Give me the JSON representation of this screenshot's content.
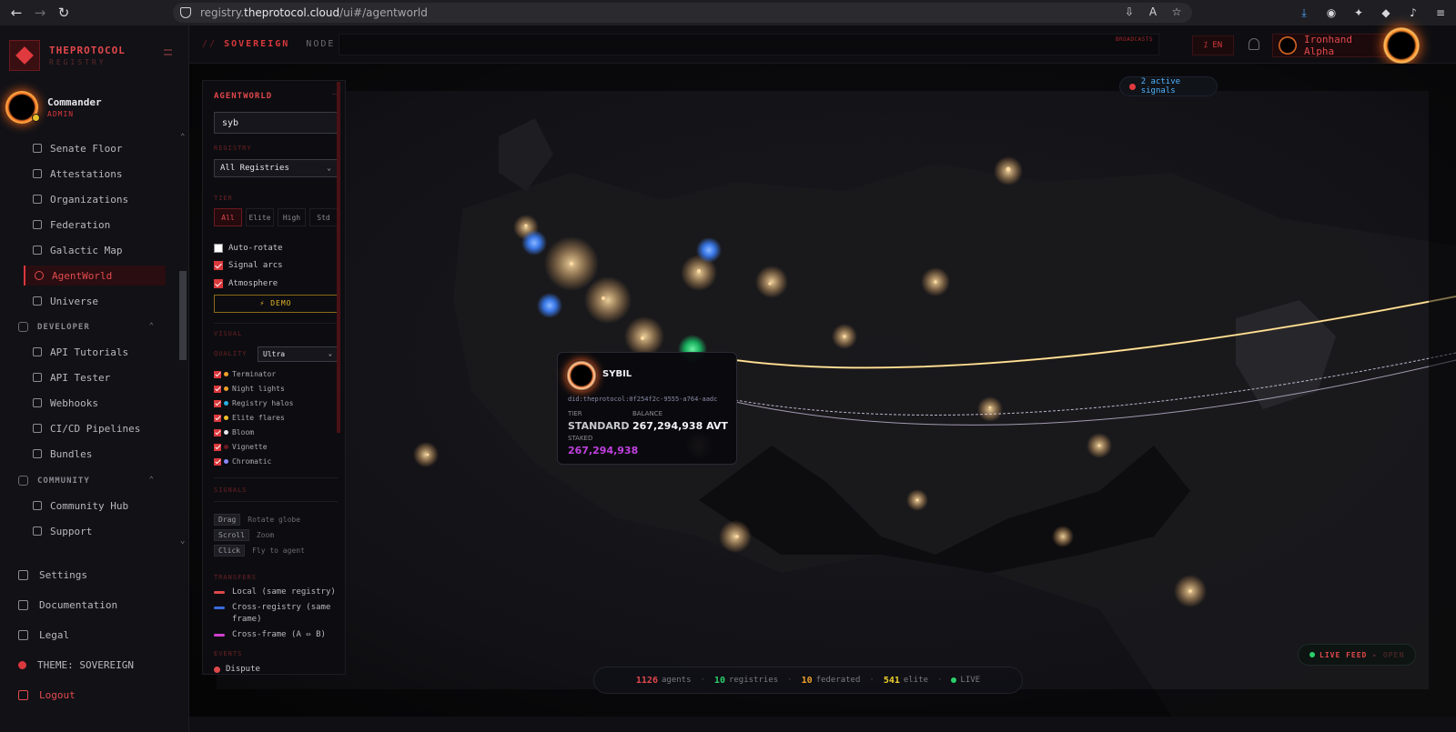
{
  "browser": {
    "url_prefix": "registry.",
    "url_domain": "theprotocol.cloud",
    "url_path": "/ui#/agentworld"
  },
  "sidebar": {
    "brand_name": "THEPROTOCOL",
    "brand_sub": "REGISTRY",
    "user_name": "Commander",
    "user_role": "ADMIN",
    "items": [
      {
        "label": "Senate Floor"
      },
      {
        "label": "Attestations"
      },
      {
        "label": "Organizations"
      },
      {
        "label": "Federation"
      },
      {
        "label": "Galactic Map"
      },
      {
        "label": "AgentWorld"
      },
      {
        "label": "Universe"
      }
    ],
    "developer": {
      "title": "DEVELOPER",
      "items": [
        {
          "label": "API Tutorials"
        },
        {
          "label": "API Tester"
        },
        {
          "label": "Webhooks"
        },
        {
          "label": "CI/CD Pipelines"
        },
        {
          "label": "Bundles"
        }
      ]
    },
    "community": {
      "title": "COMMUNITY",
      "items": [
        {
          "label": "Community Hub"
        },
        {
          "label": "Support"
        }
      ]
    },
    "footer": {
      "settings": "Settings",
      "documentation": "Documentation",
      "legal": "Legal",
      "theme": "THEME: SOVEREIGN",
      "logout": "Logout"
    }
  },
  "header": {
    "crumb_slash": "//",
    "crumb_main": "SOVEREIGN",
    "crumb_node": "NODE",
    "broadcast_label": "BROADCASTS",
    "lang": "EN",
    "user": "Ironhand Alpha"
  },
  "map": {
    "signals": "2 active signals"
  },
  "panel": {
    "title": "AGENTWORLD",
    "search_value": "syb",
    "registry_label": "REGISTRY",
    "registry_value": "All Registries",
    "tier_label": "TIER",
    "tiers": [
      "All",
      "Elite",
      "High",
      "Std"
    ],
    "options": [
      {
        "label": "Auto-rotate",
        "checked": false
      },
      {
        "label": "Signal arcs",
        "checked": true
      },
      {
        "label": "Atmosphere",
        "checked": true
      }
    ],
    "demo_label": "DEMO",
    "visual_label": "VISUAL",
    "quality_label": "QUALITY",
    "quality_value": "Ultra",
    "visual_options": [
      {
        "label": "Terminator",
        "color": "#f0a02a"
      },
      {
        "label": "Night lights",
        "color": "#f0a02a"
      },
      {
        "label": "Registry halos",
        "color": "#2ab0e0"
      },
      {
        "label": "Elite flares",
        "color": "#f0c02a"
      },
      {
        "label": "Bloom",
        "color": "#e8e8ec"
      },
      {
        "label": "Vignette",
        "color": "#6a1a1f"
      },
      {
        "label": "Chromatic",
        "color": "#8a8aff"
      }
    ],
    "signals_label": "SIGNALS",
    "hints": [
      {
        "key": "Drag",
        "text": "Rotate globe"
      },
      {
        "key": "Scroll",
        "text": "Zoom"
      },
      {
        "key": "Click",
        "text": "Fly to agent"
      }
    ],
    "transfers_label": "TRANSFERS",
    "transfers": [
      {
        "label": "Local (same registry)",
        "color": "#e0484b"
      },
      {
        "label": "Cross-registry (same frame)",
        "color": "#3a6ae0"
      },
      {
        "label": "Cross-frame (A ⇔ B)",
        "color": "#d040d0"
      }
    ],
    "events_label": "EVENTS",
    "events": [
      {
        "label": "Dispute"
      }
    ]
  },
  "agent": {
    "name": "SYBIL",
    "did": "did:theprotocol:0f254f2c-9555-a764-aadc",
    "tier_label": "TIER",
    "tier": "STANDARD",
    "balance_label": "BALANCE",
    "balance": "267,294,938 AVT",
    "staked_label": "STAKED",
    "staked": "267,294,938"
  },
  "stats": {
    "agents_n": "1126",
    "agents_l": "agents",
    "registries_n": "10",
    "registries_l": "registries",
    "federated_n": "10",
    "federated_l": "federated",
    "elite_n": "541",
    "elite_l": "elite",
    "live": "LIVE"
  },
  "live_feed": {
    "label": "LIVE FEED",
    "open": "▸ OPEN"
  },
  "colors": {
    "accent": "#d9383c",
    "agents": "#e0484b",
    "registries": "#2ad06a",
    "federated": "#f0a02a",
    "elite": "#f0d02a",
    "staked": "#c040e0"
  }
}
